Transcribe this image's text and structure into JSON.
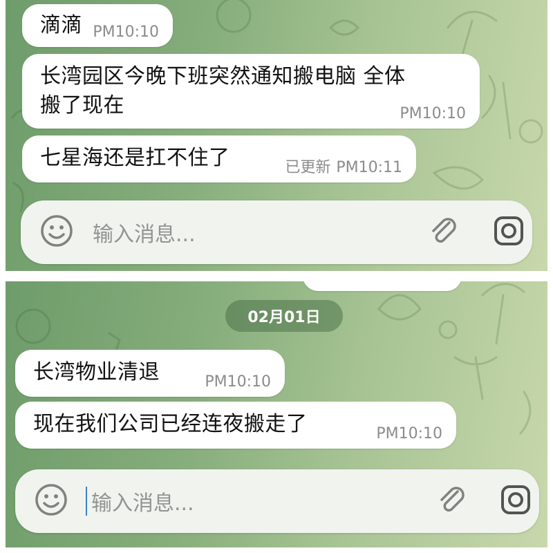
{
  "top_screenshot": {
    "messages": [
      {
        "text_lines": [
          "滴滴"
        ],
        "time": "PM10:10",
        "edited_label": ""
      },
      {
        "text_lines": [
          "长湾园区今晚下班突然通知搬电脑  全体",
          "搬了现在"
        ],
        "time": "PM10:10",
        "edited_label": ""
      },
      {
        "text_lines": [
          "七星海还是扛不住了"
        ],
        "time": "PM10:11",
        "edited_label": "已更新"
      }
    ],
    "input": {
      "placeholder": "输入消息..."
    }
  },
  "bottom_screenshot": {
    "date_separator": "02月01日",
    "messages": [
      {
        "text_lines": [
          "长湾物业清退"
        ],
        "time": "PM10:10"
      },
      {
        "text_lines": [
          "现在我们公司已经连夜搬走了"
        ],
        "time": "PM10:10"
      }
    ],
    "input": {
      "placeholder": "输入消息..."
    }
  },
  "icons": {
    "emoji": "smile-icon",
    "attach": "paperclip-icon",
    "camera": "camera-icon"
  },
  "colors": {
    "background_gradient_start": "#6e9c6a",
    "background_gradient_end": "#c8d8ac",
    "bubble": "#ffffff",
    "meta_text": "#8b8b8b",
    "input_bar": "#f1f3ef",
    "caret": "#3b82c4"
  }
}
